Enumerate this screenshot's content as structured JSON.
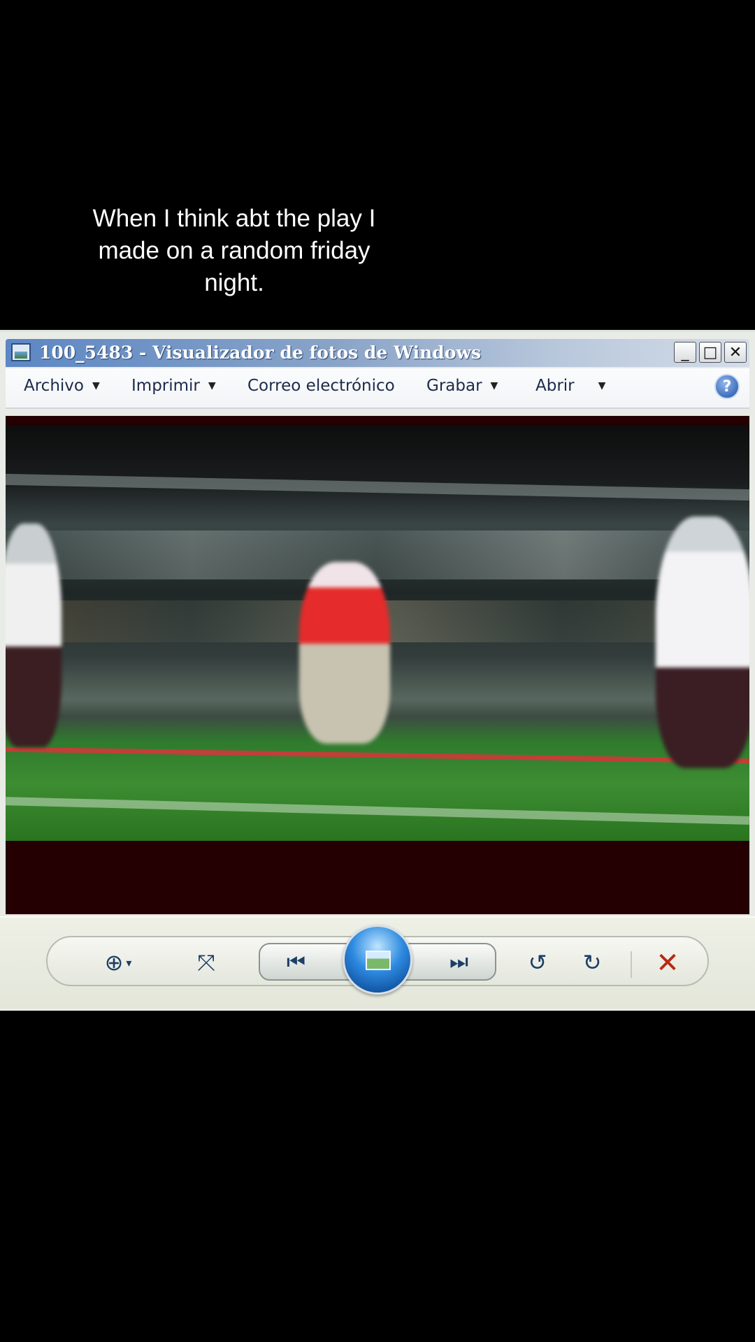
{
  "caption": {
    "text": "When I think abt the play I made on a random friday night."
  },
  "window": {
    "title": "100_5483 - Visualizador de fotos de Windows",
    "controls": {
      "minimize_glyph": "_",
      "maximize_glyph": "□",
      "close_glyph": "✕"
    }
  },
  "menu": {
    "items": [
      {
        "label": "Archivo",
        "has_dropdown": true
      },
      {
        "label": "Imprimir",
        "has_dropdown": true
      },
      {
        "label": "Correo electrónico",
        "has_dropdown": false
      },
      {
        "label": "Grabar",
        "has_dropdown": true
      },
      {
        "label": "Abrir",
        "has_dropdown": true
      }
    ],
    "help_glyph": "?"
  },
  "toolbar": {
    "zoom_glyph": "⊕",
    "zoom_caret": "▾",
    "fit_glyph": "⤧",
    "prev_glyph": "⏮",
    "next_glyph": "⏭",
    "rotate_left_glyph": "↺",
    "rotate_right_glyph": "↻",
    "delete_glyph": "✕"
  },
  "colors": {
    "viewer_background": "#240003",
    "titlebar_start": "#5c87c4",
    "delete_red": "#b82a12",
    "accent_blue": "#1e3e66"
  }
}
